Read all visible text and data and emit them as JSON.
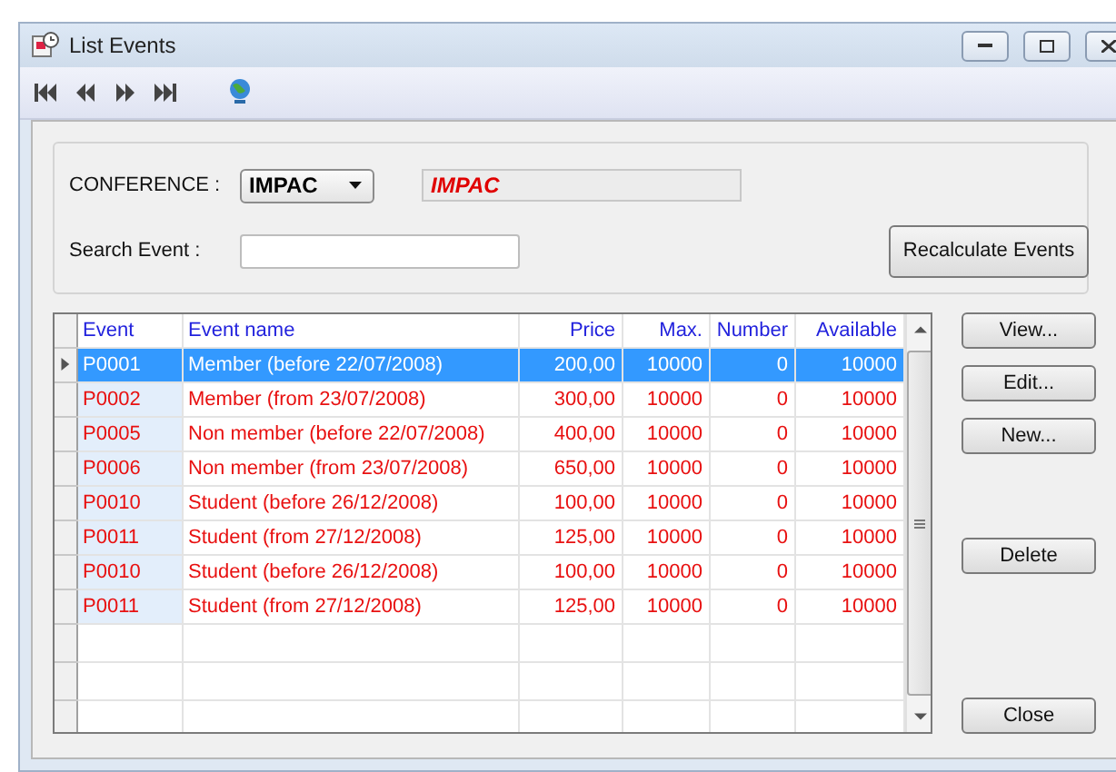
{
  "window": {
    "title": "List Events"
  },
  "filter": {
    "conference_label": "CONFERENCE :",
    "conference_value": "IMPAC",
    "conference_display": "IMPAC",
    "search_label": "Search Event :",
    "recalculate_button": "Recalculate Events"
  },
  "table": {
    "columns": [
      "Event",
      "Event name",
      "Price",
      "Max.",
      "Number",
      "Available"
    ],
    "rows": [
      {
        "selected": true,
        "cells": [
          "P0001",
          "Member (before 22/07/2008)",
          "200,00",
          "10000",
          "0",
          "10000"
        ]
      },
      {
        "selected": false,
        "cells": [
          "P0002",
          "Member (from 23/07/2008)",
          "300,00",
          "10000",
          "0",
          "10000"
        ]
      },
      {
        "selected": false,
        "cells": [
          "P0005",
          "Non member (before 22/07/2008)",
          "400,00",
          "10000",
          "0",
          "10000"
        ]
      },
      {
        "selected": false,
        "cells": [
          "P0006",
          "Non member (from 23/07/2008)",
          "650,00",
          "10000",
          "0",
          "10000"
        ]
      },
      {
        "selected": false,
        "cells": [
          "P0010",
          "Student (before 26/12/2008)",
          "100,00",
          "10000",
          "0",
          "10000"
        ]
      },
      {
        "selected": false,
        "cells": [
          "P0011",
          "Student (from 27/12/2008)",
          "125,00",
          "10000",
          "0",
          "10000"
        ]
      },
      {
        "selected": false,
        "cells": [
          "P0010",
          "Student (before 26/12/2008)",
          "100,00",
          "10000",
          "0",
          "10000"
        ]
      },
      {
        "selected": false,
        "cells": [
          "P0011",
          "Student (from 27/12/2008)",
          "125,00",
          "10000",
          "0",
          "10000"
        ]
      }
    ]
  },
  "side_buttons": [
    {
      "label": "View...",
      "kind": "top"
    },
    {
      "label": "Edit...",
      "kind": "top"
    },
    {
      "label": "New...",
      "kind": "top"
    },
    {
      "label": "Delete",
      "kind": "middle"
    },
    {
      "label": "Close",
      "kind": "bottom"
    }
  ]
}
